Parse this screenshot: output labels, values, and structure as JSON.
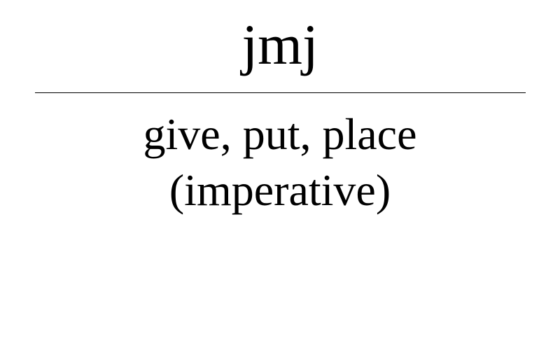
{
  "card": {
    "term": "jmj",
    "gloss_line_1": "give, put, place",
    "gloss_line_2": "(imperative)"
  },
  "colors": {
    "background": "#ffffff",
    "text": "#000000",
    "divider": "#000000"
  }
}
